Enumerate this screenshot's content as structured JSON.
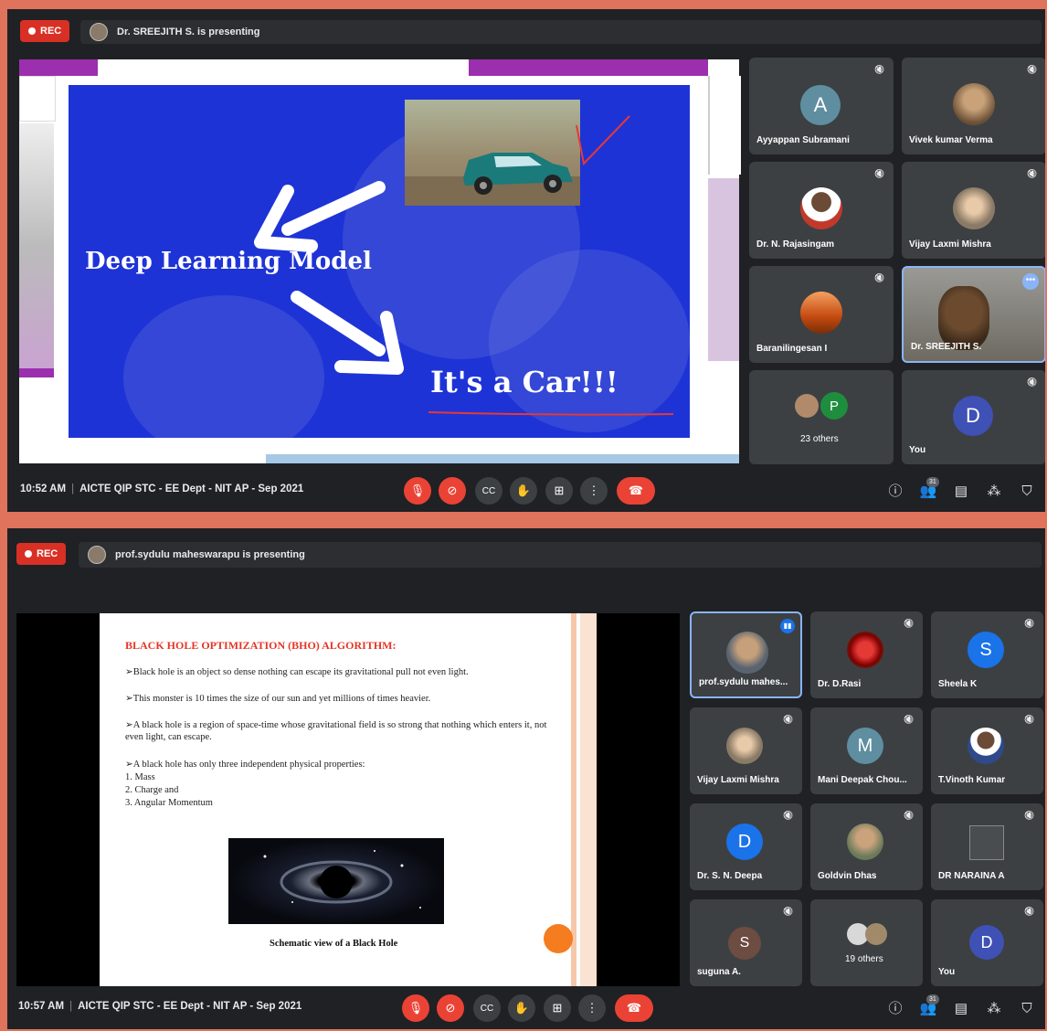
{
  "screens": [
    {
      "rec_label": "REC",
      "presenting_text": "Dr. SREEJITH S. is presenting",
      "slide": {
        "heading": "Deep Learning Model",
        "result": "It's a Car!!!"
      },
      "participants": [
        {
          "name": "Ayyappan Subramani",
          "avatar_letter": "A",
          "avatar_color": "#5f8ea0"
        },
        {
          "name": "Vivek kumar Verma",
          "avatar_letter": "",
          "avatar_color": "#7a6650"
        },
        {
          "name": "Dr. N. Rajasingam",
          "avatar_letter": "",
          "avatar_color": "#c0392b"
        },
        {
          "name": "Vijay Laxmi Mishra",
          "avatar_letter": "",
          "avatar_color": "#a89a88"
        },
        {
          "name": "Baranilingesan I",
          "avatar_letter": "",
          "avatar_color": "#d35400"
        },
        {
          "name": "Dr. SREEJITH S.",
          "avatar_letter": "",
          "avatar_color": "#6b5a44"
        },
        {
          "name": "23 others",
          "avatar_letter": "P",
          "avatar_color": "#1e8e3e"
        },
        {
          "name": "You",
          "avatar_letter": "D",
          "avatar_color": "#3f51b5"
        }
      ],
      "time": "10:52 AM",
      "meeting_title": "AICTE QIP STC - EE Dept - NIT AP - Sep 2021",
      "people_count": "31"
    },
    {
      "rec_label": "REC",
      "presenting_text": "prof.sydulu maheswarapu is presenting",
      "slide": {
        "title": "BLACK HOLE OPTIMIZATION (BHO) ALGORITHM:",
        "bullets": [
          "➢Black hole is an object so dense nothing can escape its gravitational pull not even light.",
          "➢This monster is 10 times the size of our sun and yet millions of times heavier.",
          "➢A black hole is a region of space-time whose gravitational field is so strong that nothing which enters it, not even light, can escape.",
          "➢A black hole has only three independent physical properties:"
        ],
        "properties": [
          "1.   Mass",
          "2.   Charge and",
          "3.   Angular Momentum"
        ],
        "caption": "Schematic view of a Black Hole"
      },
      "participants": [
        {
          "name": "prof.sydulu mahes...",
          "avatar_letter": "",
          "avatar_color": "#7a8a9a"
        },
        {
          "name": "Dr. D.Rasi",
          "avatar_letter": "",
          "avatar_color": "#b71c1c"
        },
        {
          "name": "Sheela K",
          "avatar_letter": "S",
          "avatar_color": "#1a73e8"
        },
        {
          "name": "Vijay Laxmi Mishra",
          "avatar_letter": "",
          "avatar_color": "#a89a88"
        },
        {
          "name": "Mani Deepak Chou...",
          "avatar_letter": "M",
          "avatar_color": "#5f8ea0"
        },
        {
          "name": "T.Vinoth Kumar",
          "avatar_letter": "",
          "avatar_color": "#2e4a8a"
        },
        {
          "name": "Dr. S. N. Deepa",
          "avatar_letter": "D",
          "avatar_color": "#1a73e8"
        },
        {
          "name": "Goldvin Dhas",
          "avatar_letter": "",
          "avatar_color": "#8a8a7a"
        },
        {
          "name": "DR NARAINA A",
          "avatar_letter": "",
          "avatar_color": "#5f6368"
        },
        {
          "name": "suguna A.",
          "avatar_letter": "S",
          "avatar_color": "#6d4c41"
        },
        {
          "name": "19 others",
          "avatar_letter": "",
          "avatar_color": "#9aa0a6"
        },
        {
          "name": "You",
          "avatar_letter": "D",
          "avatar_color": "#3f51b5"
        }
      ],
      "time": "10:57 AM",
      "meeting_title": "AICTE QIP STC - EE Dept - NIT AP - Sep 2021",
      "people_count": "31"
    }
  ],
  "controls": {
    "mic_icon": "mic-off-icon",
    "camera_icon": "camera-off-icon",
    "captions_icon": "captions-icon",
    "raise_hand_icon": "raise-hand-icon",
    "present_icon": "present-icon",
    "more_icon": "more-options-icon",
    "hangup_icon": "hang-up-icon",
    "red": "#ea4335"
  }
}
